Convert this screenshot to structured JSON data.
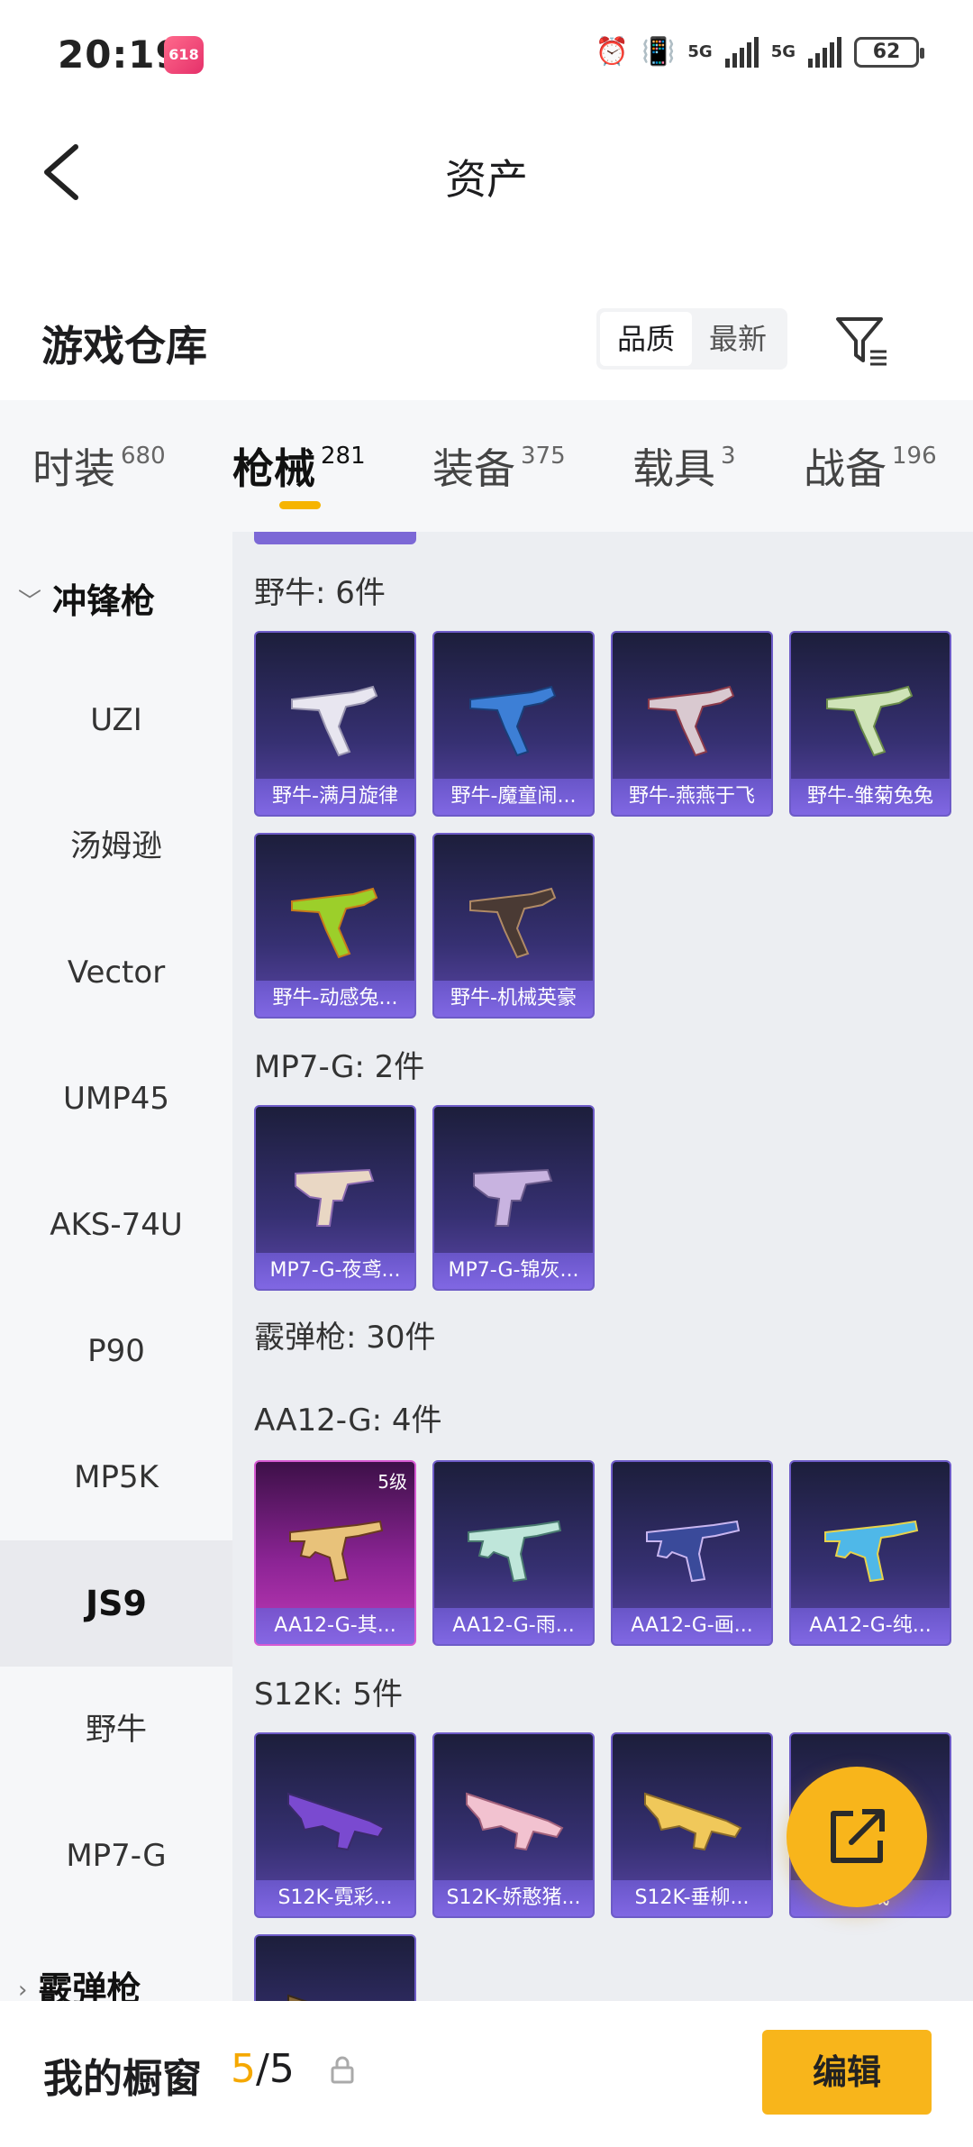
{
  "status_bar": {
    "time": "20:19",
    "badge": "618",
    "network1": "5G",
    "network2": "5G",
    "battery": "62"
  },
  "nav": {
    "title": "资产"
  },
  "header": {
    "title": "游戏仓库",
    "sort_quality": "品质",
    "sort_latest": "最新"
  },
  "tabs": [
    {
      "label": "时装",
      "count": "680"
    },
    {
      "label": "枪械",
      "count": "281"
    },
    {
      "label": "装备",
      "count": "375"
    },
    {
      "label": "载具",
      "count": "3"
    },
    {
      "label": "战备",
      "count": "196"
    }
  ],
  "sidebar": {
    "group_open": "冲锋枪",
    "items": [
      "UZI",
      "汤姆逊",
      "Vector",
      "UMP45",
      "AKS-74U",
      "P90",
      "MP5K",
      "JS9",
      "野牛",
      "MP7-G"
    ],
    "selected": "JS9",
    "group_closed": "霰弹枪"
  },
  "groups": {
    "bizon": {
      "title": "野牛: 6件",
      "items": [
        "野牛-满月旋律",
        "野牛-魔童闹...",
        "野牛-燕燕于飞",
        "野牛-雏菊兔兔",
        "野牛-动感兔...",
        "野牛-机械英豪"
      ]
    },
    "mp7": {
      "title": "MP7-G: 2件",
      "items": [
        "MP7-G-夜鸢...",
        "MP7-G-锦灰..."
      ]
    },
    "shotgun": {
      "title": "霰弹枪: 30件"
    },
    "aa12": {
      "title": "AA12-G: 4件",
      "level": "5级",
      "items": [
        "AA12-G-其...",
        "AA12-G-雨...",
        "AA12-G-画...",
        "AA12-G-纯..."
      ]
    },
    "s12k": {
      "title": "S12K: 5件",
      "items": [
        "S12K-霓彩...",
        "S12K-娇憨猪...",
        "S12K-垂柳...",
        "...戏"
      ]
    }
  },
  "bottom": {
    "label": "我的橱窗",
    "count_current": "5",
    "count_sep": "/",
    "count_total": "5",
    "edit": "编辑"
  },
  "colors": {
    "accent": "#f8b51b",
    "card_purple": "#363072",
    "card_pink": "#8c2495"
  }
}
